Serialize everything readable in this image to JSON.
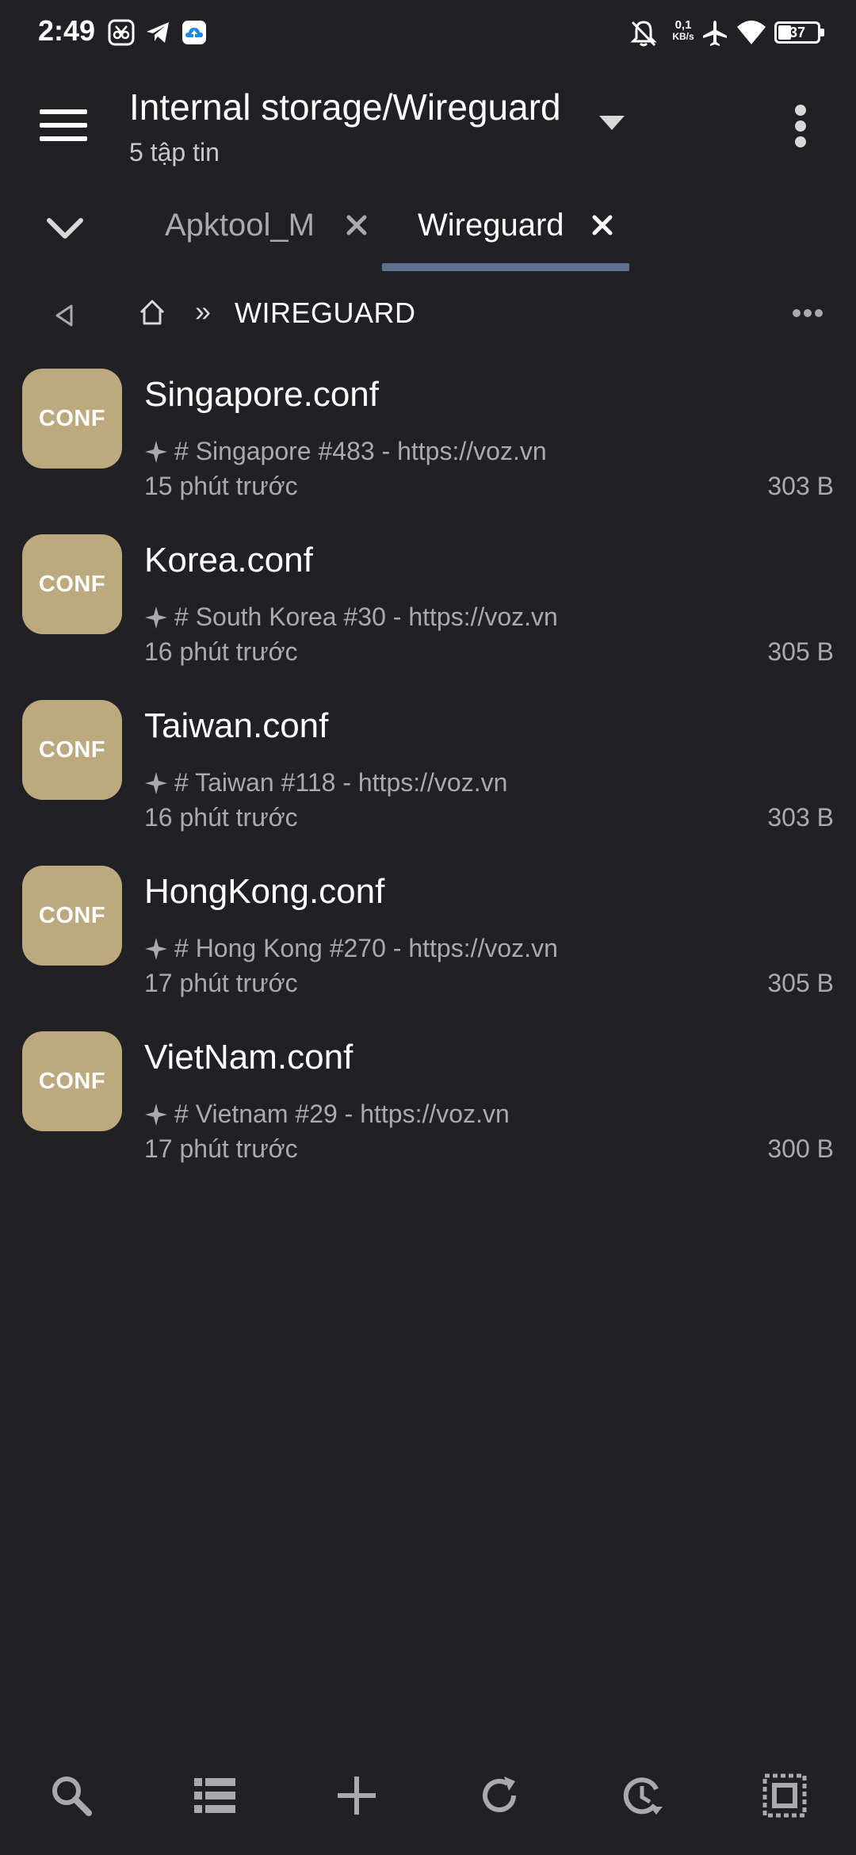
{
  "status_bar": {
    "time": "2:49",
    "net_speed_value": "0,1",
    "net_speed_unit": "KB/s",
    "battery": "37"
  },
  "header": {
    "path": "Internal storage/Wireguard",
    "file_count": "5 tập tin"
  },
  "tabs": [
    {
      "label": "Apktool_M",
      "active": false
    },
    {
      "label": "Wireguard",
      "active": true
    }
  ],
  "breadcrumb": {
    "separator": "»",
    "current": "WIREGUARD"
  },
  "files": [
    {
      "thumb": "CONF",
      "name": "Singapore.conf",
      "desc": "# Singapore #483 - https://voz.vn",
      "modified": "15 phút trước",
      "size": "303 B"
    },
    {
      "thumb": "CONF",
      "name": "Korea.conf",
      "desc": "# South Korea #30 - https://voz.vn",
      "modified": "16 phút trước",
      "size": "305 B"
    },
    {
      "thumb": "CONF",
      "name": "Taiwan.conf",
      "desc": "# Taiwan #118 - https://voz.vn",
      "modified": "16 phút trước",
      "size": "303 B"
    },
    {
      "thumb": "CONF",
      "name": "HongKong.conf",
      "desc": "# Hong Kong #270 - https://voz.vn",
      "modified": "17 phút trước",
      "size": "305 B"
    },
    {
      "thumb": "CONF",
      "name": "VietNam.conf",
      "desc": "# Vietnam #29 - https://voz.vn",
      "modified": "17 phút trước",
      "size": "300 B"
    }
  ],
  "bottom_toolbar": [
    "search-icon",
    "list-view-icon",
    "plus-icon",
    "refresh-icon",
    "history-icon",
    "select-all-icon"
  ],
  "colors": {
    "background": "#202025",
    "accent_underline": "#5c7090",
    "thumb": "#bda97e",
    "secondary_text": "#a9a9ae"
  }
}
